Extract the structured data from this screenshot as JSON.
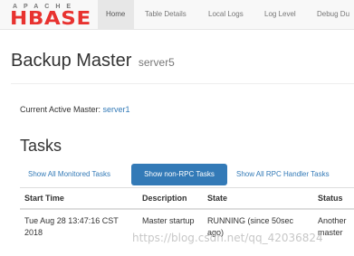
{
  "logo": {
    "apache": "APACHE",
    "hbase": "HBASE"
  },
  "nav": {
    "items": [
      {
        "label": "Home",
        "active": true
      },
      {
        "label": "Table Details"
      },
      {
        "label": "Local Logs"
      },
      {
        "label": "Log Level"
      },
      {
        "label": "Debug Du"
      }
    ]
  },
  "header": {
    "title": "Backup Master",
    "server": "server5"
  },
  "active_master": {
    "label": "Current Active Master:",
    "server": "server1"
  },
  "tasks": {
    "heading": "Tasks",
    "tabs": [
      {
        "label": "Show All Monitored Tasks"
      },
      {
        "label": "Show non-RPC Tasks",
        "selected": true
      },
      {
        "label": "Show All RPC Handler Tasks"
      }
    ],
    "columns": [
      "Start Time",
      "Description",
      "State",
      "Status"
    ],
    "rows": [
      {
        "start_time": "Tue Aug 28 13:47:16 CST 2018",
        "description": "Master startup",
        "state": "RUNNING (since 50sec ago)",
        "status": "Another master"
      }
    ]
  },
  "watermark": "https://blog.csdn.net/qq_42036824",
  "colors": {
    "brand": "#e8322f",
    "link": "#337ab7",
    "navbar": "#f8f8f8"
  }
}
